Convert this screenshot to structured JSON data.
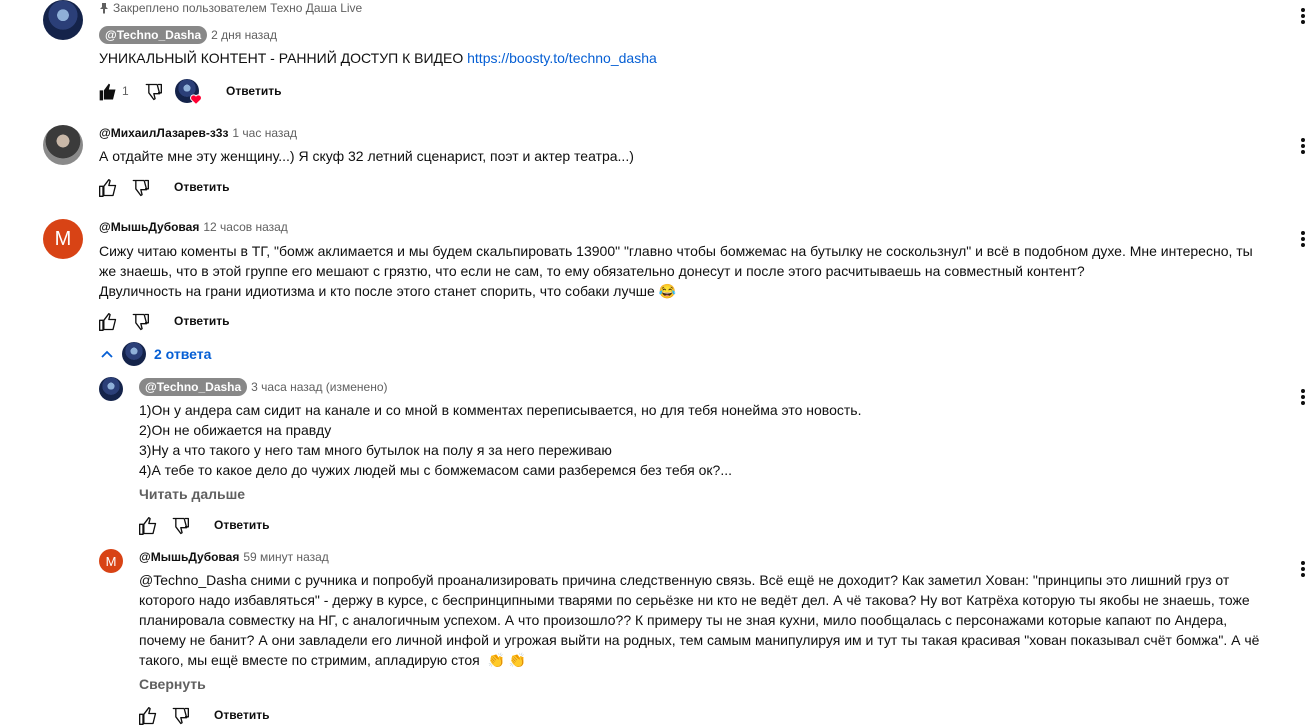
{
  "comments": [
    {
      "pinned_label": "Закреплено пользователем Техно Даша Live",
      "author": "@Techno_Dasha",
      "time": "2 дня назад",
      "text_prefix": "УНИКАЛЬНЫЙ КОНТЕНТ - РАННИЙ ДОСТУП К ВИДЕО ",
      "link": "https://boosty.to/techno_dasha",
      "likes": "1",
      "reply_label": "Ответить"
    },
    {
      "author": "@МихаилЛазарев-з3з",
      "time": "1 час назад",
      "text": "А отдайте мне эту женщину...) Я скуф 32 летний сценарист, поэт и актер театра...)",
      "reply_label": "Ответить"
    },
    {
      "avatar_letter": "М",
      "author": "@МышьДубовая",
      "time": "12 часов назад",
      "lines": [
        "Сижу читаю коменты в ТГ, \"бомж аклимается и мы будем скальпировать 13900\" \"главно чтобы бомжемас на бутылку не соскользнул\" и всё в подобном духе. Мне интересно, ты",
        "же знаешь, что в этой группе его мешают с грязтю, что если не сам, то ему обязательно донесут и после этого расчитываешь на совместный контент?",
        "Двуличность на грани идиотизма и кто после этого станет спорить, что собаки лучше"
      ],
      "emoji": "😂",
      "reply_label": "Ответить",
      "replies_toggle": "2 ответа"
    }
  ],
  "replies": [
    {
      "author": "@Techno_Dasha",
      "time": "3 часа назад (изменено)",
      "lines": [
        "1)Он у андера сам сидит на канале и со мной в комментах переписывается, но для тебя нонейма это новость.",
        "2)Он не обижается на правду",
        "3)Ну а что такого у него там много бутылок на полу я за него переживаю",
        "4)А тебе то какое дело до чужих людей мы с бомжемасом сами разберемся без тебя ок?..."
      ],
      "more_label": "Читать дальше",
      "reply_label": "Ответить"
    },
    {
      "avatar_letter": "М",
      "author": "@МышьДубовая",
      "time": "59 минут назад",
      "lines": [
        "@Techno_Dasha  сними с ручника и попробуй проанализировать причина следственную связь. Всё ещё не доходит? Как заметил Хован: \"принципы это лишний груз от",
        "которого надо избавляться\" - держу в курсе, с беспринципными тварями по серьёзке ни кто не ведёт дел. А чё такова? Ну вот Катрёха которую ты якобы не знаешь, тоже",
        "планировала совместку на НГ, с аналогичным успехом. А что произошло?? К примеру ты не зная кухни, мило пообщалась с персонажами которые капают по Андера,",
        "почему не банит? А они завладели его личной инфой и угрожая выйти на родных, тем самым манипулируя им  и тут ты такая красивая \"хован показывал счёт бомжа\". А чё",
        "такого, мы ещё вместе по стримим, апладирую стоя"
      ],
      "emoji": "👏 👏",
      "less_label": "Свернуть",
      "reply_label": "Ответить"
    }
  ],
  "icons": [
    "pin-icon",
    "like-icon",
    "dislike-icon",
    "heart-icon",
    "chevron-up-icon",
    "more-vert-icon"
  ],
  "colors": {
    "link": "#065fd4",
    "author_chip": "#888888",
    "letter_avatar": "#d84315",
    "heart": "#ff0033",
    "secondary_text": "#606060"
  }
}
